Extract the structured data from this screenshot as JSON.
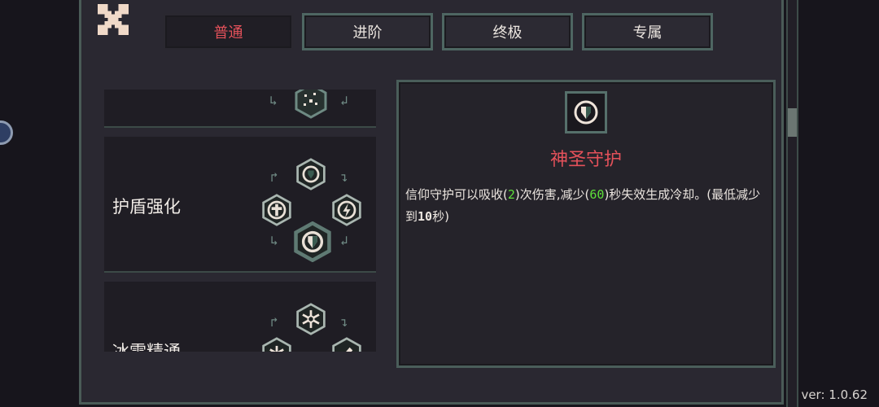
{
  "tabs": [
    {
      "label": "普通",
      "active": true
    },
    {
      "label": "进阶",
      "active": false
    },
    {
      "label": "终极",
      "active": false
    },
    {
      "label": "专属",
      "active": false
    }
  ],
  "skills": [
    {
      "name": ""
    },
    {
      "name": "护盾强化"
    },
    {
      "name": "冰雪精通"
    }
  ],
  "detail": {
    "title": "神圣守护",
    "desc_parts": [
      "信仰守护可以吸收(",
      "2",
      ")次伤害,减少(",
      "60",
      ")秒失效生成冷却。(最低减少到",
      "10",
      "秒)"
    ]
  },
  "version": "ver: 1.0.62",
  "colors": {
    "accent_red": "#e4515a",
    "highlight_green": "#5ee03a",
    "frame": "#4a5b57"
  },
  "icons": [
    "close-icon",
    "shield-icon",
    "cross-icon",
    "lightning-icon",
    "snowflake-icon",
    "sparkle-icon"
  ]
}
